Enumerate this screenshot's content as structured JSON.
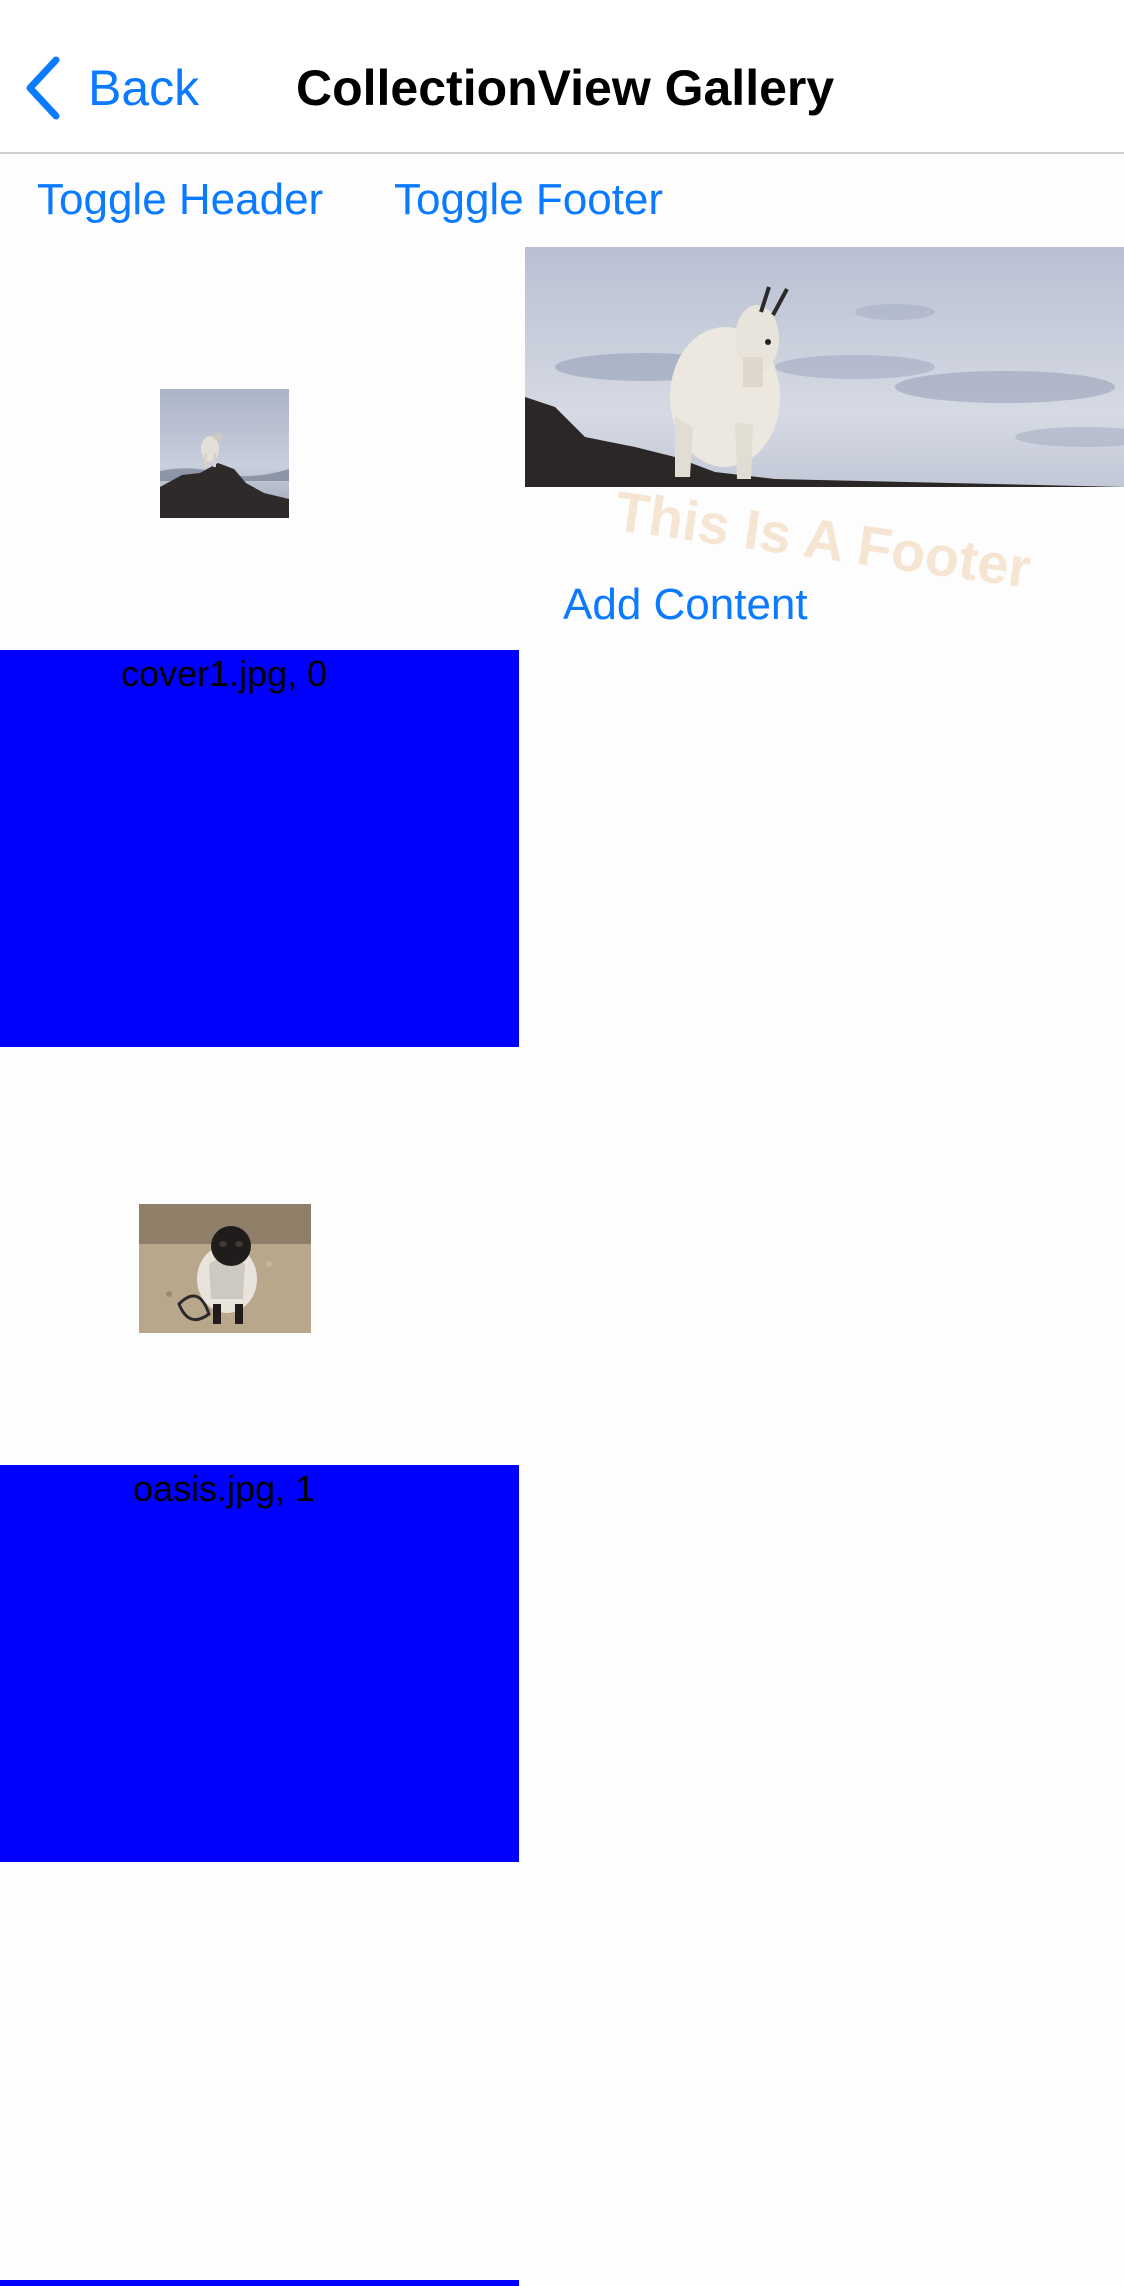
{
  "nav": {
    "back_label": "Back",
    "title": "CollectionView Gallery"
  },
  "toolbar": {
    "toggle_header_label": "Toggle Header",
    "toggle_footer_label": "Toggle Footer"
  },
  "header": {
    "image": "mountain-goat-photo",
    "footer_text": "This Is A Footer",
    "add_content_label": "Add Content"
  },
  "gallery": {
    "items": [
      {
        "caption": "cover1.jpg, 0",
        "image": "mountain-goat-thumbnail"
      },
      {
        "caption": "oasis.jpg, 1",
        "image": "pug-dog-thumbnail"
      }
    ]
  },
  "colors": {
    "accent": "#0a7aff",
    "label_background": "#0000fe",
    "footer_text": "#f0c8a0"
  }
}
